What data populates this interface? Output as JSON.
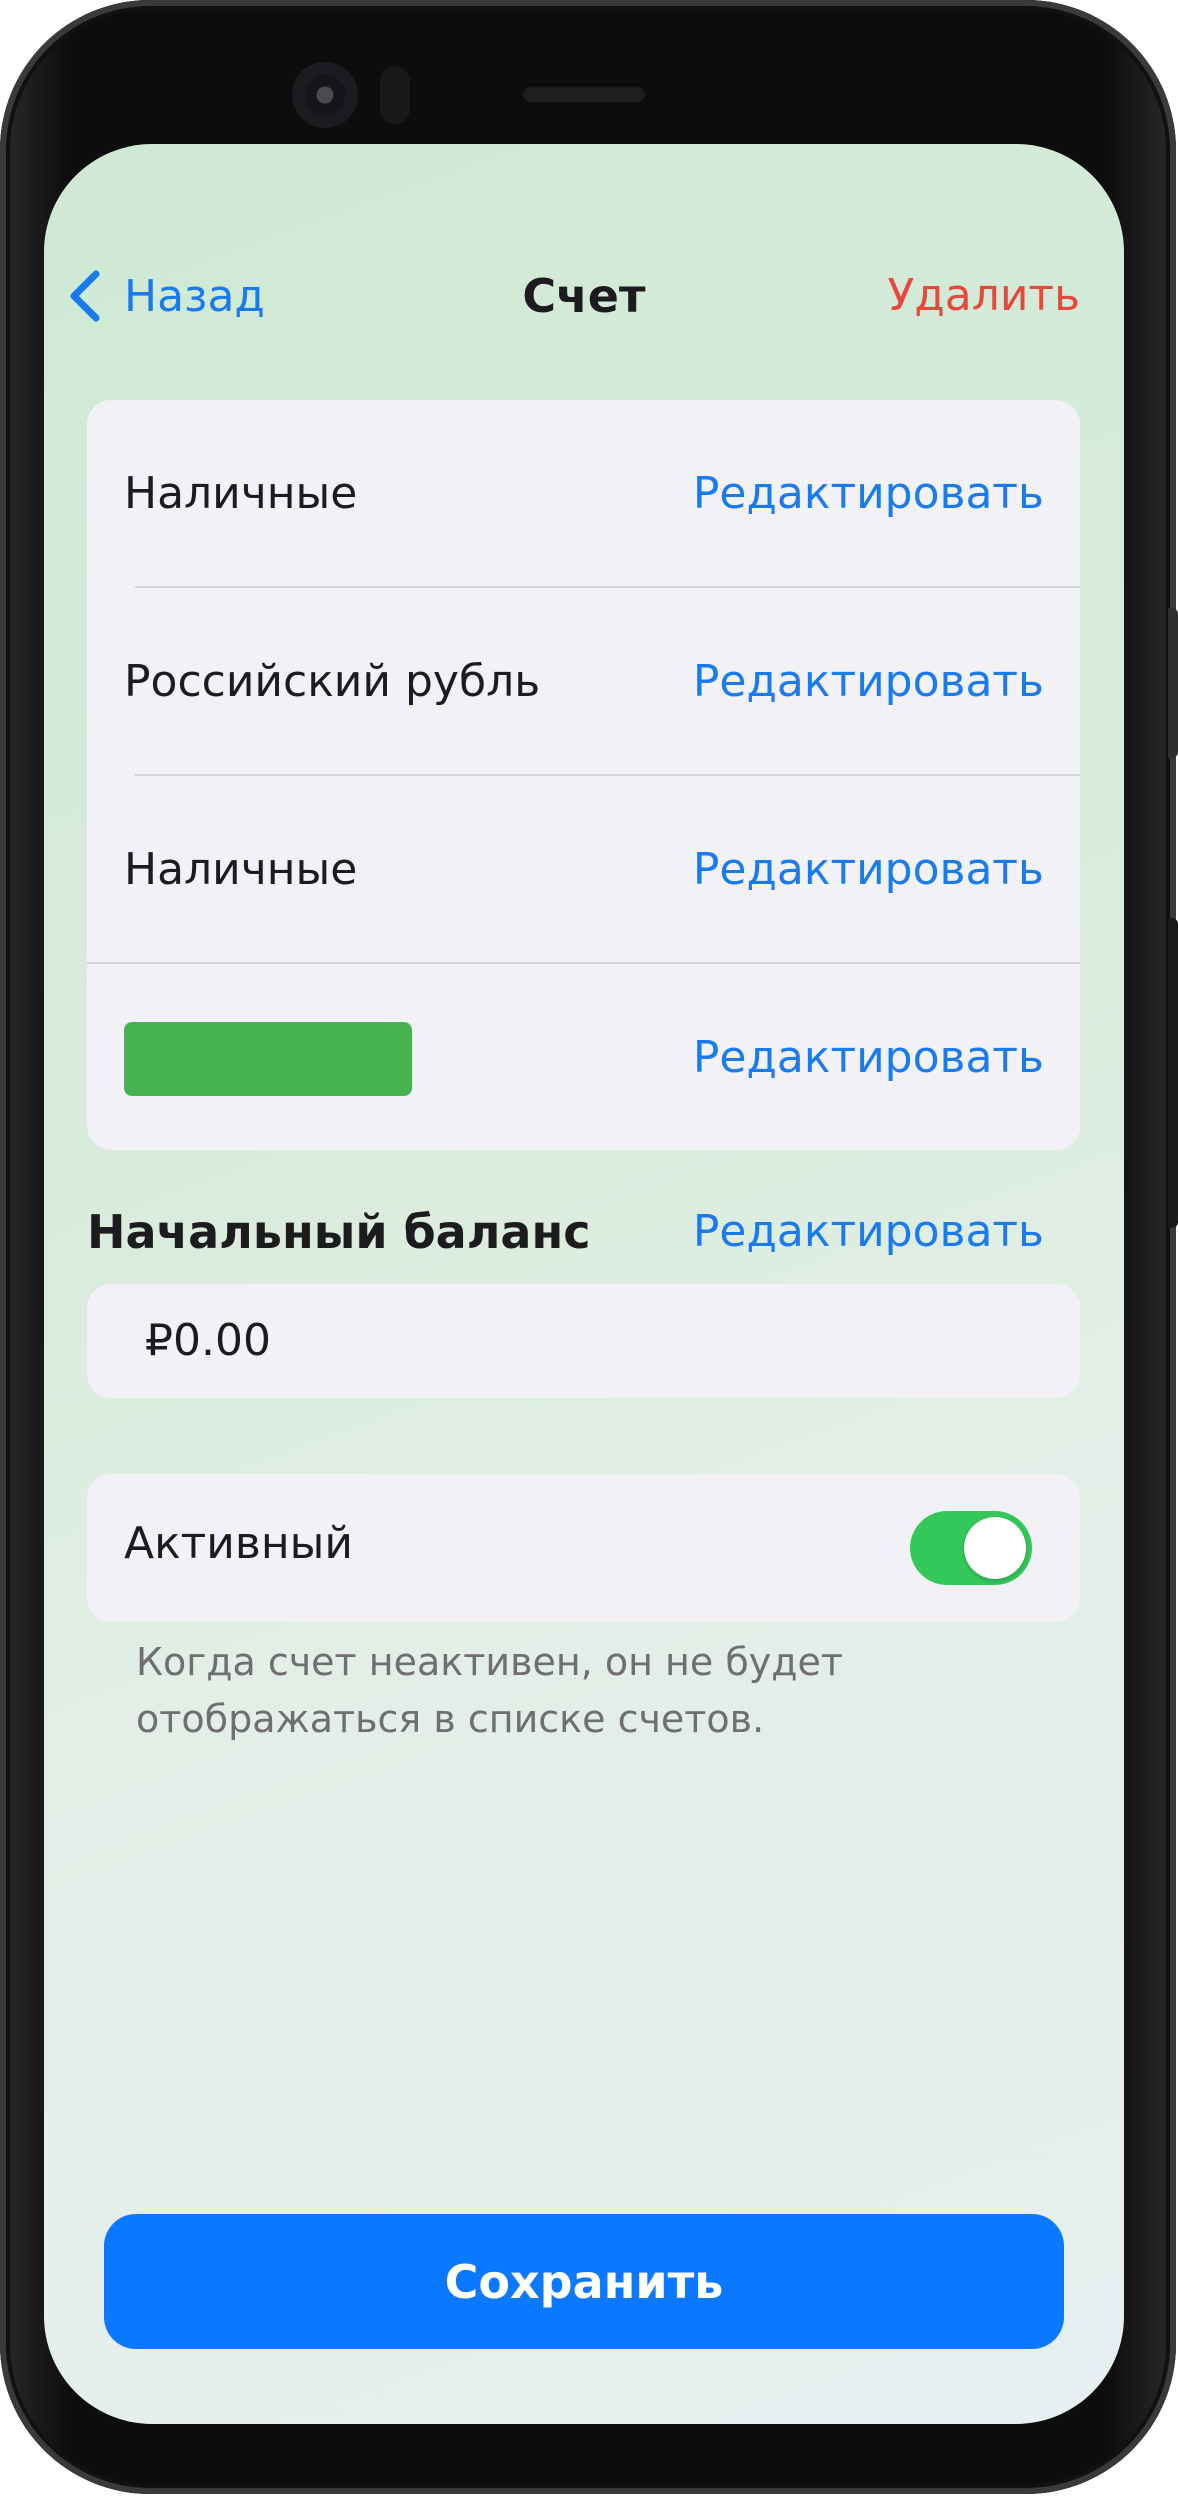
{
  "nav": {
    "back_label": "Назад",
    "title": "Счет",
    "delete_label": "Удалить"
  },
  "details": {
    "rows": [
      {
        "label": "Наличные",
        "edit_label": "Редактировать"
      },
      {
        "label": "Российский рубль",
        "edit_label": "Редактировать"
      },
      {
        "label": "Наличные",
        "edit_label": "Редактировать"
      },
      {
        "label": "",
        "edit_label": "Редактировать",
        "color": "#47b250"
      }
    ]
  },
  "balance": {
    "heading": "Начальный баланс",
    "edit_label": "Редактировать",
    "value": "₽0.00"
  },
  "active": {
    "label": "Активный",
    "enabled": true,
    "hint": "Когда счет неактивен, он не будет отображаться в списке счетов."
  },
  "save_label": "Сохранить",
  "colors": {
    "accent": "#1a7bf0",
    "destructive": "#e8473c",
    "toggle_on": "#34c759",
    "primary_button": "#0a78ff"
  }
}
